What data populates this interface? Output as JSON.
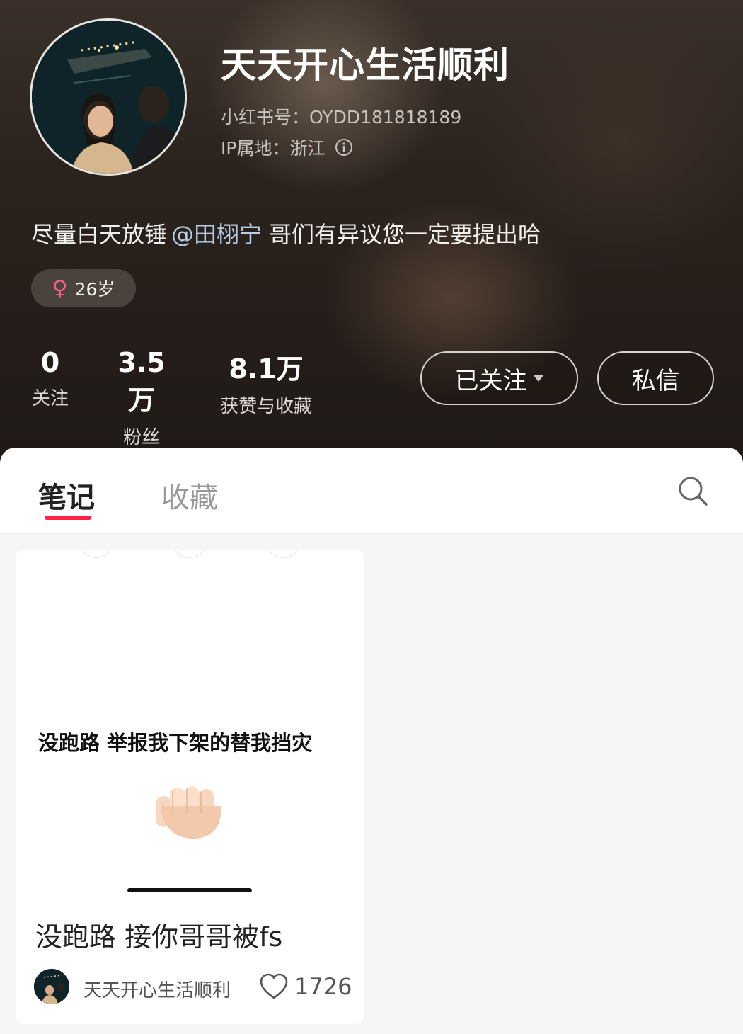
{
  "profile": {
    "username": "天天开心生活顺利",
    "id_text": "小红书号：OYDD181818189",
    "ip_text": "IP属地：浙江",
    "bio_before": "尽量白天放锤",
    "bio_mention": "@田栩宁",
    "bio_after": "哥们有异议您一定要提出哈",
    "gender_symbol": "♀",
    "age_text": "26岁"
  },
  "stats": {
    "following_value": "0",
    "following_label": "关注",
    "followers_value": "3.5万",
    "followers_label": "粉丝",
    "likes_value": "8.1万",
    "likes_label": "获赞与收藏"
  },
  "actions": {
    "follow_label": "已关注",
    "message_label": "私信"
  },
  "tabs": {
    "notes_label": "笔记",
    "collect_label": "收藏"
  },
  "note": {
    "cover_text": "没跑路 举报我下架的替我挡灾",
    "title": "没跑路 接你哥哥被fs",
    "author": "天天开心生活顺利",
    "likes": "1726"
  },
  "colors": {
    "accent": "#ff2442",
    "mention": "#b8cde6",
    "gender": "#ff5a8a"
  },
  "icons": [
    "info-icon",
    "female-icon",
    "dropdown-caret-icon",
    "search-icon",
    "heart-icon"
  ]
}
